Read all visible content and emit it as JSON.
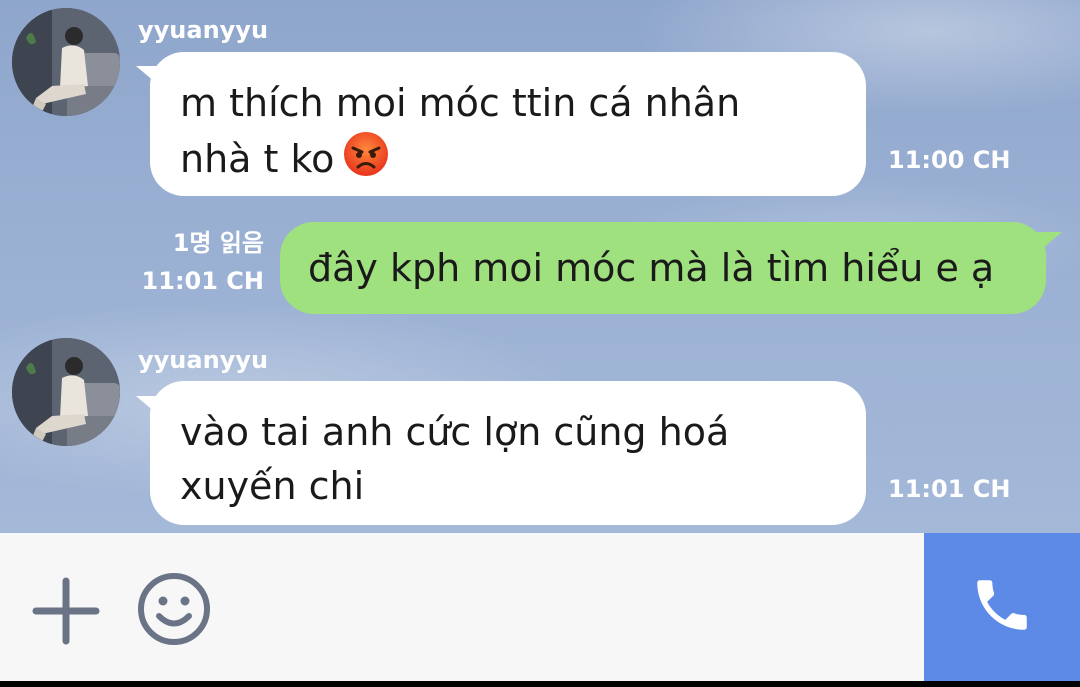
{
  "colors": {
    "incoming_bubble": "#ffffff",
    "outgoing_bubble": "#9fe07f",
    "call_button": "#5c8ae6",
    "input_bar": "#f7f7f7"
  },
  "messages": [
    {
      "direction": "incoming",
      "sender": "yyuanyyu",
      "lines": [
        "m thích moi móc ttin cá nhân",
        "nhà t ko"
      ],
      "emoji": "angry-face",
      "time": "11:00 CH"
    },
    {
      "direction": "outgoing",
      "read_status": "1명 읽음",
      "text": "đây kph moi móc mà là tìm hiểu e ạ",
      "time": "11:01 CH"
    },
    {
      "direction": "incoming",
      "sender": "yyuanyyu",
      "lines": [
        "vào tai anh cức lợn cũng hoá",
        "xuyến chi"
      ],
      "time": "11:01 CH"
    }
  ],
  "input_bar": {
    "add_icon": "plus-icon",
    "emoji_icon": "smiley-icon",
    "call_icon": "phone-icon"
  }
}
